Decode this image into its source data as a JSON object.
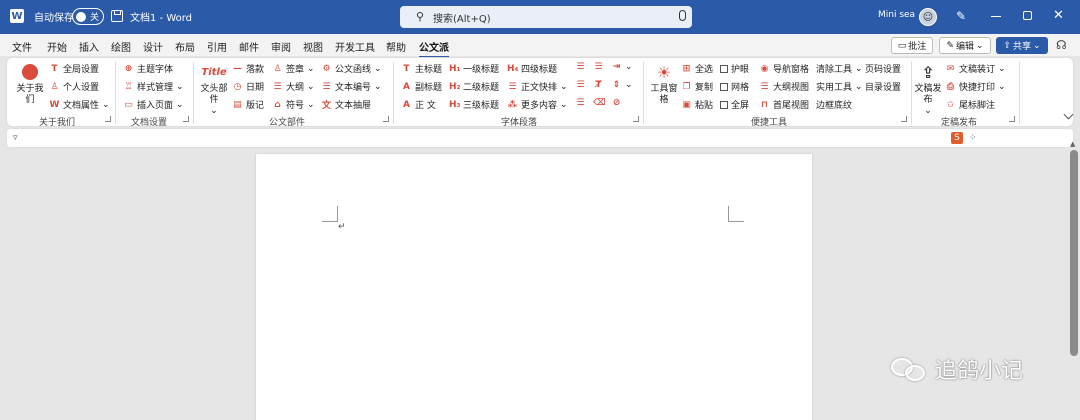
{
  "titlebar": {
    "autosave_label": "自动保存",
    "autosave_state": "关",
    "doc_title": "文档1 - Word",
    "search_placeholder": "搜索(Alt+Q)",
    "user_name": "Mini sea"
  },
  "menu": [
    "文件",
    "开始",
    "插入",
    "绘图",
    "设计",
    "布局",
    "引用",
    "邮件",
    "审阅",
    "视图",
    "开发工具",
    "帮助",
    "公文派"
  ],
  "menu_active": "公文派",
  "actions": {
    "comment": "批注",
    "edit": "编辑",
    "share": "共享"
  },
  "ribbon": {
    "about": {
      "label": "关于我们",
      "big": "关于我们",
      "items": [
        "全局设置",
        "个人设置",
        "文档属性"
      ]
    },
    "docset": {
      "label": "文档设置",
      "items": [
        "主题字体",
        "样式管理",
        "插入页面"
      ]
    },
    "official": {
      "label": "公文部件",
      "big": "文头部件",
      "col1": [
        "落款",
        "日期",
        "版记"
      ],
      "col2": [
        "签章",
        "大纲",
        "符号"
      ],
      "col3": [
        "公文函线",
        "文本编号",
        "文本抽屉"
      ]
    },
    "font": {
      "label": "字体段落",
      "col1": [
        "主标题",
        "副标题",
        "正  文"
      ],
      "col2": [
        "一级标题",
        "二级标题",
        "三级标题"
      ],
      "col3": [
        "四级标题",
        "正文快排",
        "更多内容"
      ]
    },
    "tools": {
      "label": "便捷工具",
      "big": "工具窗格",
      "col1": [
        "全选",
        "复制",
        "粘贴"
      ],
      "col2": [
        "护眼",
        "网格",
        "全屏"
      ],
      "col3": [
        "导航窗格",
        "大纲视图",
        "首尾视图"
      ],
      "col4": [
        "清除工具",
        "实用工具",
        "边框底纹"
      ],
      "col5": [
        "页码设置",
        "目录设置"
      ]
    },
    "publish": {
      "label": "定稿发布",
      "big": "文稿发布",
      "items": [
        "文稿装订",
        "快捷打印",
        "尾标脚注"
      ]
    }
  },
  "watermark": "追鸽小记",
  "colors": {
    "accent": "#2b5aa8",
    "icon_red": "#d94b3b"
  }
}
